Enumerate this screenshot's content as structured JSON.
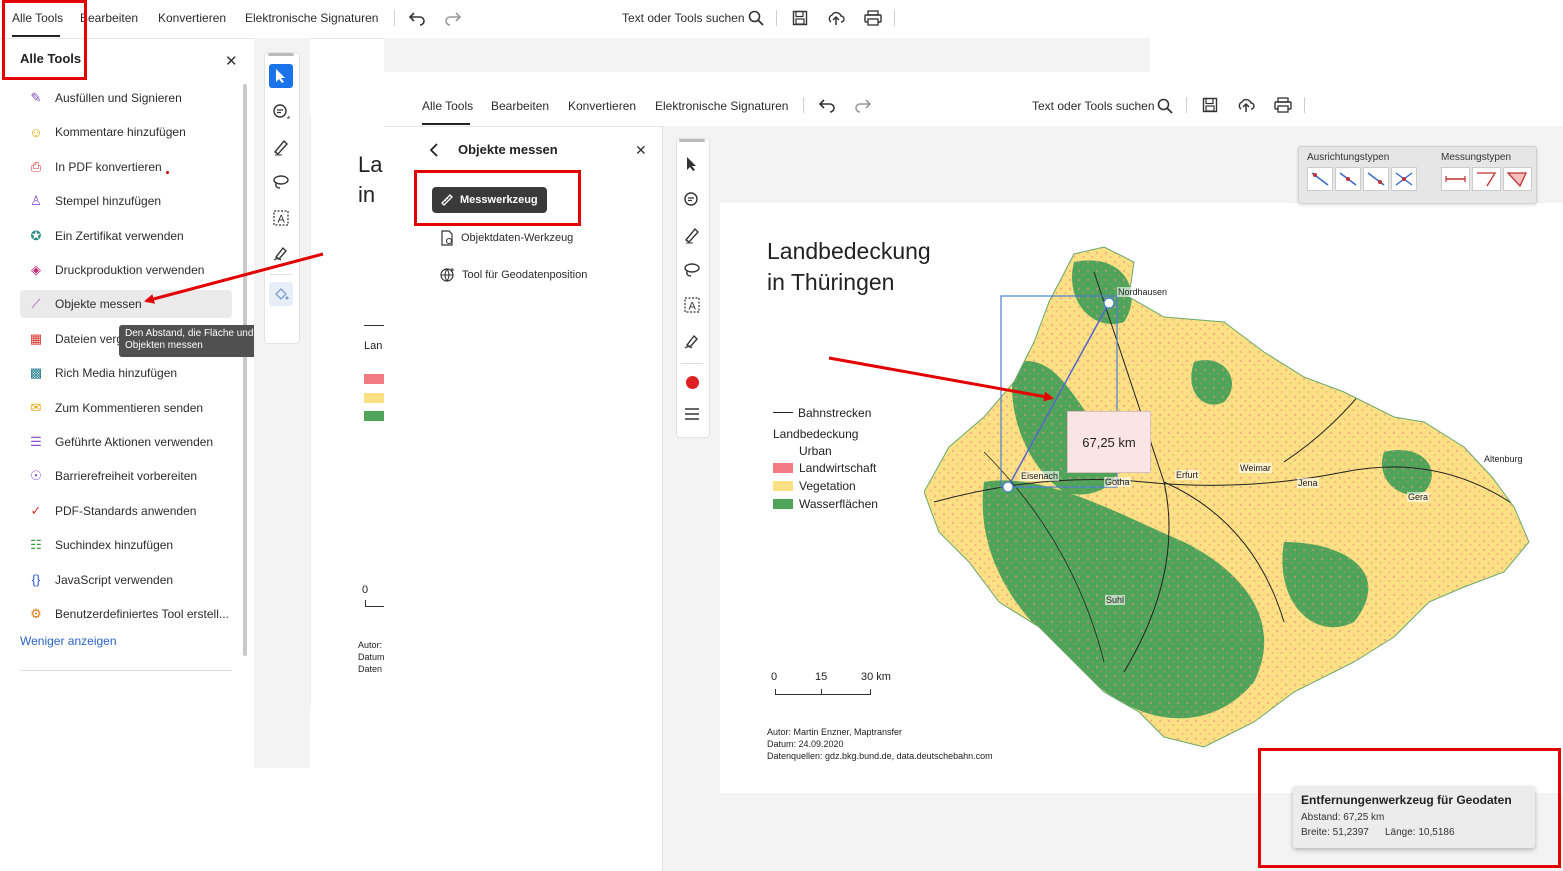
{
  "back_window": {
    "menu": {
      "all_tools": "Alle Tools",
      "edit": "Bearbeiten",
      "convert": "Konvertieren",
      "esign": "Elektronische Signaturen"
    },
    "search": "Text oder Tools suchen",
    "panel_title": "Alle Tools",
    "tools": [
      {
        "label": "Ausfüllen und Signieren",
        "icon": "fill-sign-icon",
        "color": "#7c4dbd"
      },
      {
        "label": "Kommentare hinzufügen",
        "icon": "comment-icon",
        "color": "#e6a700"
      },
      {
        "label": "In PDF konvertieren",
        "icon": "pdf-convert-icon",
        "color": "#d9302c"
      },
      {
        "label": "Stempel hinzufügen",
        "icon": "stamp-icon",
        "color": "#8a4fd0"
      },
      {
        "label": "Ein Zertifikat verwenden",
        "icon": "certificate-icon",
        "color": "#2e8b82"
      },
      {
        "label": "Druckproduktion verwenden",
        "icon": "print-production-icon",
        "color": "#c2307a"
      },
      {
        "label": "Objekte messen",
        "icon": "ruler-icon",
        "color": "#a347c9"
      },
      {
        "label": "Dateien verg",
        "icon": "compare-icon",
        "color": "#d9302c"
      },
      {
        "label": "Rich Media hinzufügen",
        "icon": "rich-media-icon",
        "color": "#1b7a8c"
      },
      {
        "label": "Zum Kommentieren senden",
        "icon": "send-comment-icon",
        "color": "#e6a700"
      },
      {
        "label": "Geführte Aktionen verwenden",
        "icon": "guided-actions-icon",
        "color": "#8a4fd0"
      },
      {
        "label": "Barrierefreiheit vorbereiten",
        "icon": "accessibility-icon",
        "color": "#8a4fd0"
      },
      {
        "label": "PDF-Standards anwenden",
        "icon": "pdf-standards-icon",
        "color": "#d9302c"
      },
      {
        "label": "Suchindex hinzufügen",
        "icon": "search-index-icon",
        "color": "#3a9a3a"
      },
      {
        "label": "JavaScript verwenden",
        "icon": "javascript-icon",
        "color": "#2a5bd7"
      },
      {
        "label": "Benutzerdefiniertes Tool erstell...",
        "icon": "custom-tool-icon",
        "color": "#d97a1a"
      }
    ],
    "show_less": "Weniger anzeigen",
    "tooltip": "Den Abstand, die Fläche und den Umfang von Objekten messen",
    "doc_fragments": {
      "title1": "La",
      "title2": "in",
      "legend_word": "Lan",
      "scale_zero": "0",
      "autor": "Autor:",
      "datum": "Datum",
      "daten": "Daten"
    }
  },
  "front_window": {
    "menu": {
      "all_tools": "Alle Tools",
      "edit": "Bearbeiten",
      "convert": "Konvertieren",
      "esign": "Elektronische Signaturen"
    },
    "search": "Text oder Tools suchen",
    "panel_title": "Objekte messen",
    "measure_tool": "Messwerkzeug",
    "object_data_tool": "Objektdaten-Werkzeug",
    "geodata_tool": "Tool für Geodatenposition",
    "snap": {
      "orientation_label": "Ausrichtungstypen",
      "measure_label": "Messungstypen"
    },
    "map": {
      "title_line1": "Landbedeckung",
      "title_line2": "in Thüringen",
      "legend": {
        "rail": "Bahnstrecken",
        "heading": "Landbedeckung",
        "items": [
          {
            "label": "Urban",
            "color": ""
          },
          {
            "label": "Landwirtschaft",
            "color": "#f27a82"
          },
          {
            "label": "Vegetation",
            "color": "#fbe084"
          },
          {
            "label": "Wasserflächen",
            "color": "#4ea55a"
          }
        ]
      },
      "scale": {
        "t0": "0",
        "t1": "15",
        "t2": "30 km"
      },
      "credits": {
        "author": "Autor: Martin Enzner, Maptransfer",
        "date": "Datum: 24.09.2020",
        "sources": "Datenquellen: gdz.bkg.bund.de, data.deutschebahn.com"
      },
      "cities": {
        "nordhausen": "Nordhausen",
        "eisenach": "Eisenach",
        "gotha": "Gotha",
        "erfurt": "Erfurt",
        "weimar": "Weimar",
        "jena": "Jena",
        "gera": "Gera",
        "altenburg": "Altenburg",
        "suhl": "Suhl"
      },
      "measurement_label": "67,25 km"
    },
    "geo_popup": {
      "title": "Entfernungenwerkzeug für Geodaten",
      "distance": "Abstand: 67,25 km",
      "lat": "Breite: 51,2397",
      "lon": "Länge: 10,5186"
    }
  }
}
